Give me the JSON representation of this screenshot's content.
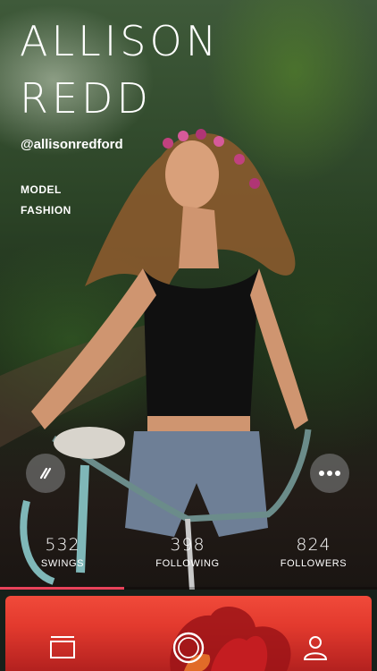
{
  "profile": {
    "name_line1": "ALLISON",
    "name_line2": "REDD",
    "handle": "@allisonredford",
    "tags": [
      "MODEL",
      "FASHION"
    ]
  },
  "actions": {
    "swing_icon": "swing-slash-icon",
    "more_icon": "more-horizontal-icon"
  },
  "stats": [
    {
      "value": "532",
      "label": "SWINGS"
    },
    {
      "value": "398",
      "label": "FOLLOWING"
    },
    {
      "value": "824",
      "label": "FOLLOWERS"
    }
  ],
  "progress": {
    "fraction": 0.33,
    "color": "#e8425a"
  },
  "tabbar": {
    "accent": "#e33a2e",
    "icons": [
      "feed-icon",
      "camera-icon",
      "profile-icon"
    ]
  }
}
